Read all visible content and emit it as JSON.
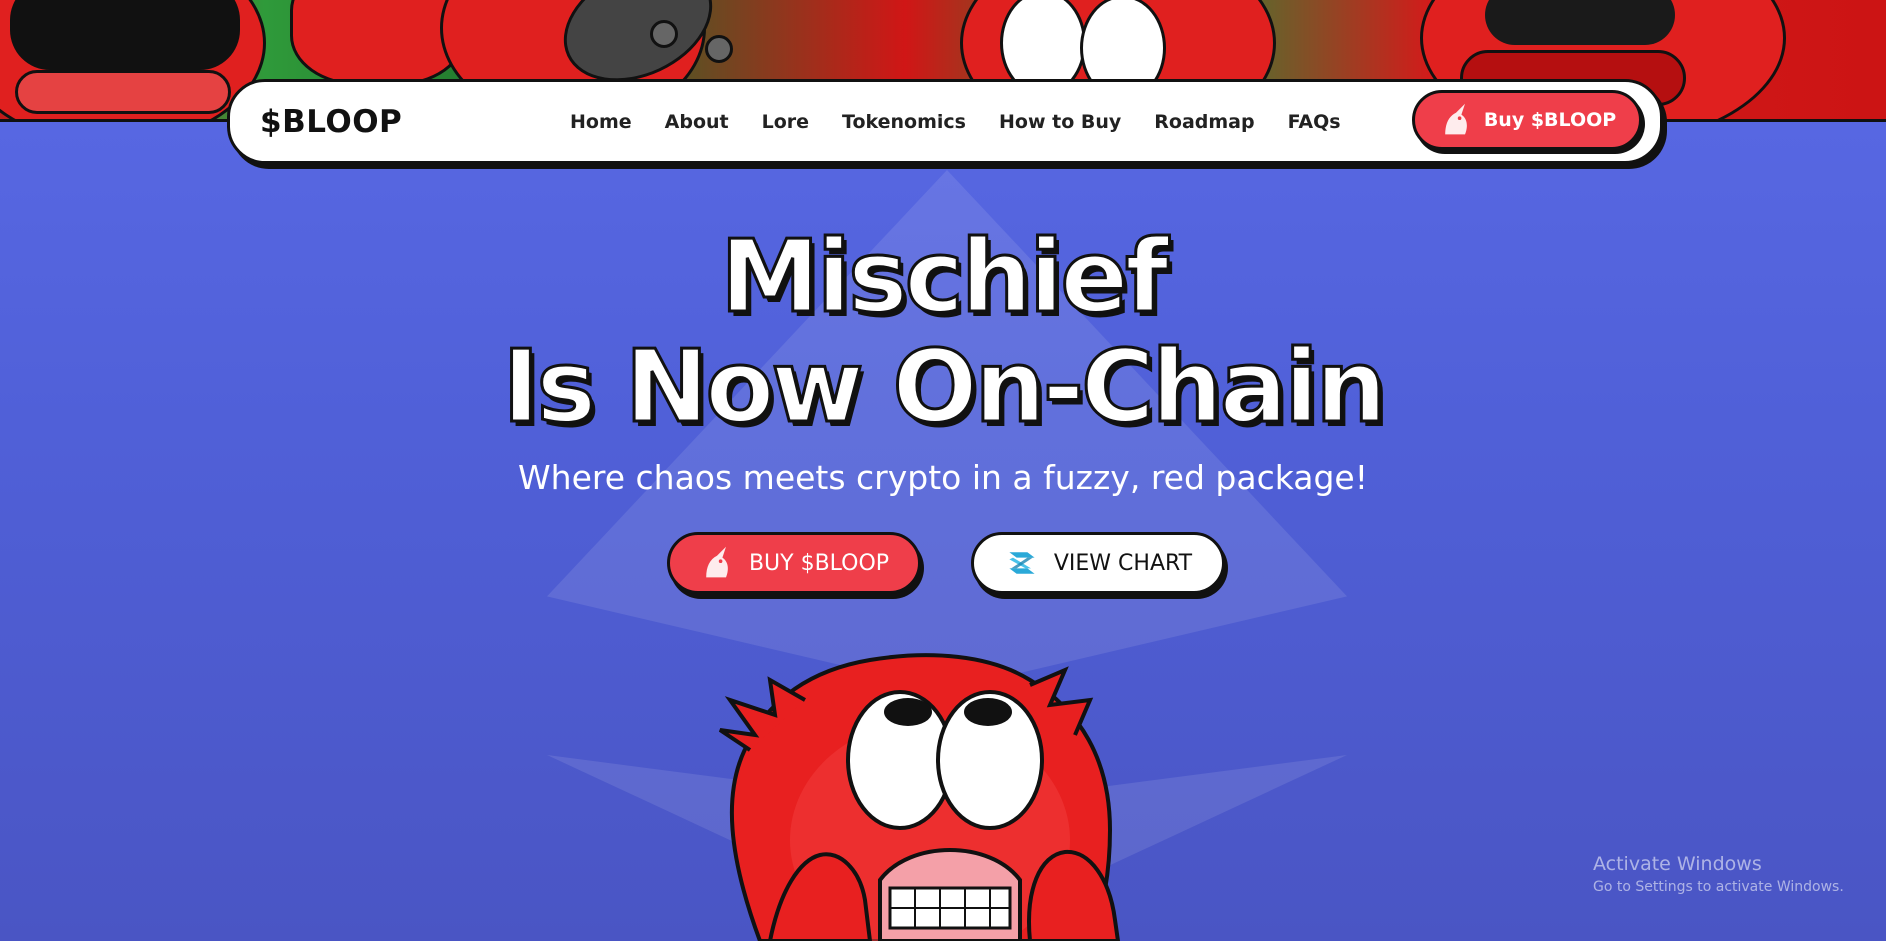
{
  "brand": {
    "logo_text": "$BLOOP"
  },
  "nav": {
    "items": [
      {
        "label": "Home"
      },
      {
        "label": "About"
      },
      {
        "label": "Lore"
      },
      {
        "label": "Tokenomics"
      },
      {
        "label": "How to Buy"
      },
      {
        "label": "Roadmap"
      },
      {
        "label": "FAQs"
      }
    ],
    "buy_button": {
      "label": "Buy $BLOOP",
      "icon": "unicorn-icon"
    }
  },
  "hero": {
    "headline_line1": "Mischief",
    "headline_line2": "Is Now On-Chain",
    "subtitle": "Where chaos meets crypto in a fuzzy, red package!",
    "buy_button": {
      "label": "BUY $BLOOP",
      "icon": "unicorn-icon"
    },
    "chart_button": {
      "label": "VIEW CHART",
      "icon": "dextools-icon"
    }
  },
  "os_watermark": {
    "title": "Activate Windows",
    "subtitle": "Go to Settings to activate Windows."
  },
  "colors": {
    "background": "#5563dc",
    "accent_red": "#ef3e4a",
    "outline": "#111111",
    "white": "#ffffff",
    "chart_icon": "#2aa9d8"
  }
}
